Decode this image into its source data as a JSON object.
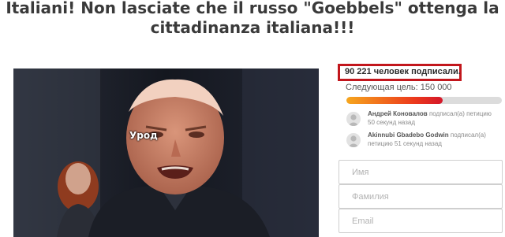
{
  "headline": {
    "line1": "Italiani! Non lasciate che il russo \"Goebbels\" ottenga la",
    "line2": "cittadinanza italiana!!!"
  },
  "photo": {
    "caption": "Урод"
  },
  "stats": {
    "signatures_text": "90 221 человек подписали.",
    "goal_text": "Следующая цель: 150 000",
    "progress_fraction": 0.62
  },
  "signers": [
    {
      "name": "Андрей Коновалов",
      "action": "подписал(а) петицию",
      "time": "50 секунд назад"
    },
    {
      "name": "Akinnubi Gbadebo Godwin",
      "action": "подписал(а)",
      "time": "петицию 51 секунд назад"
    }
  ],
  "form": {
    "first_name_placeholder": "Имя",
    "last_name_placeholder": "Фамилия",
    "email_placeholder": "Email"
  },
  "colors": {
    "highlight_border": "#c2161c",
    "progress_start": "#f6a61d",
    "progress_end": "#d4172a"
  }
}
